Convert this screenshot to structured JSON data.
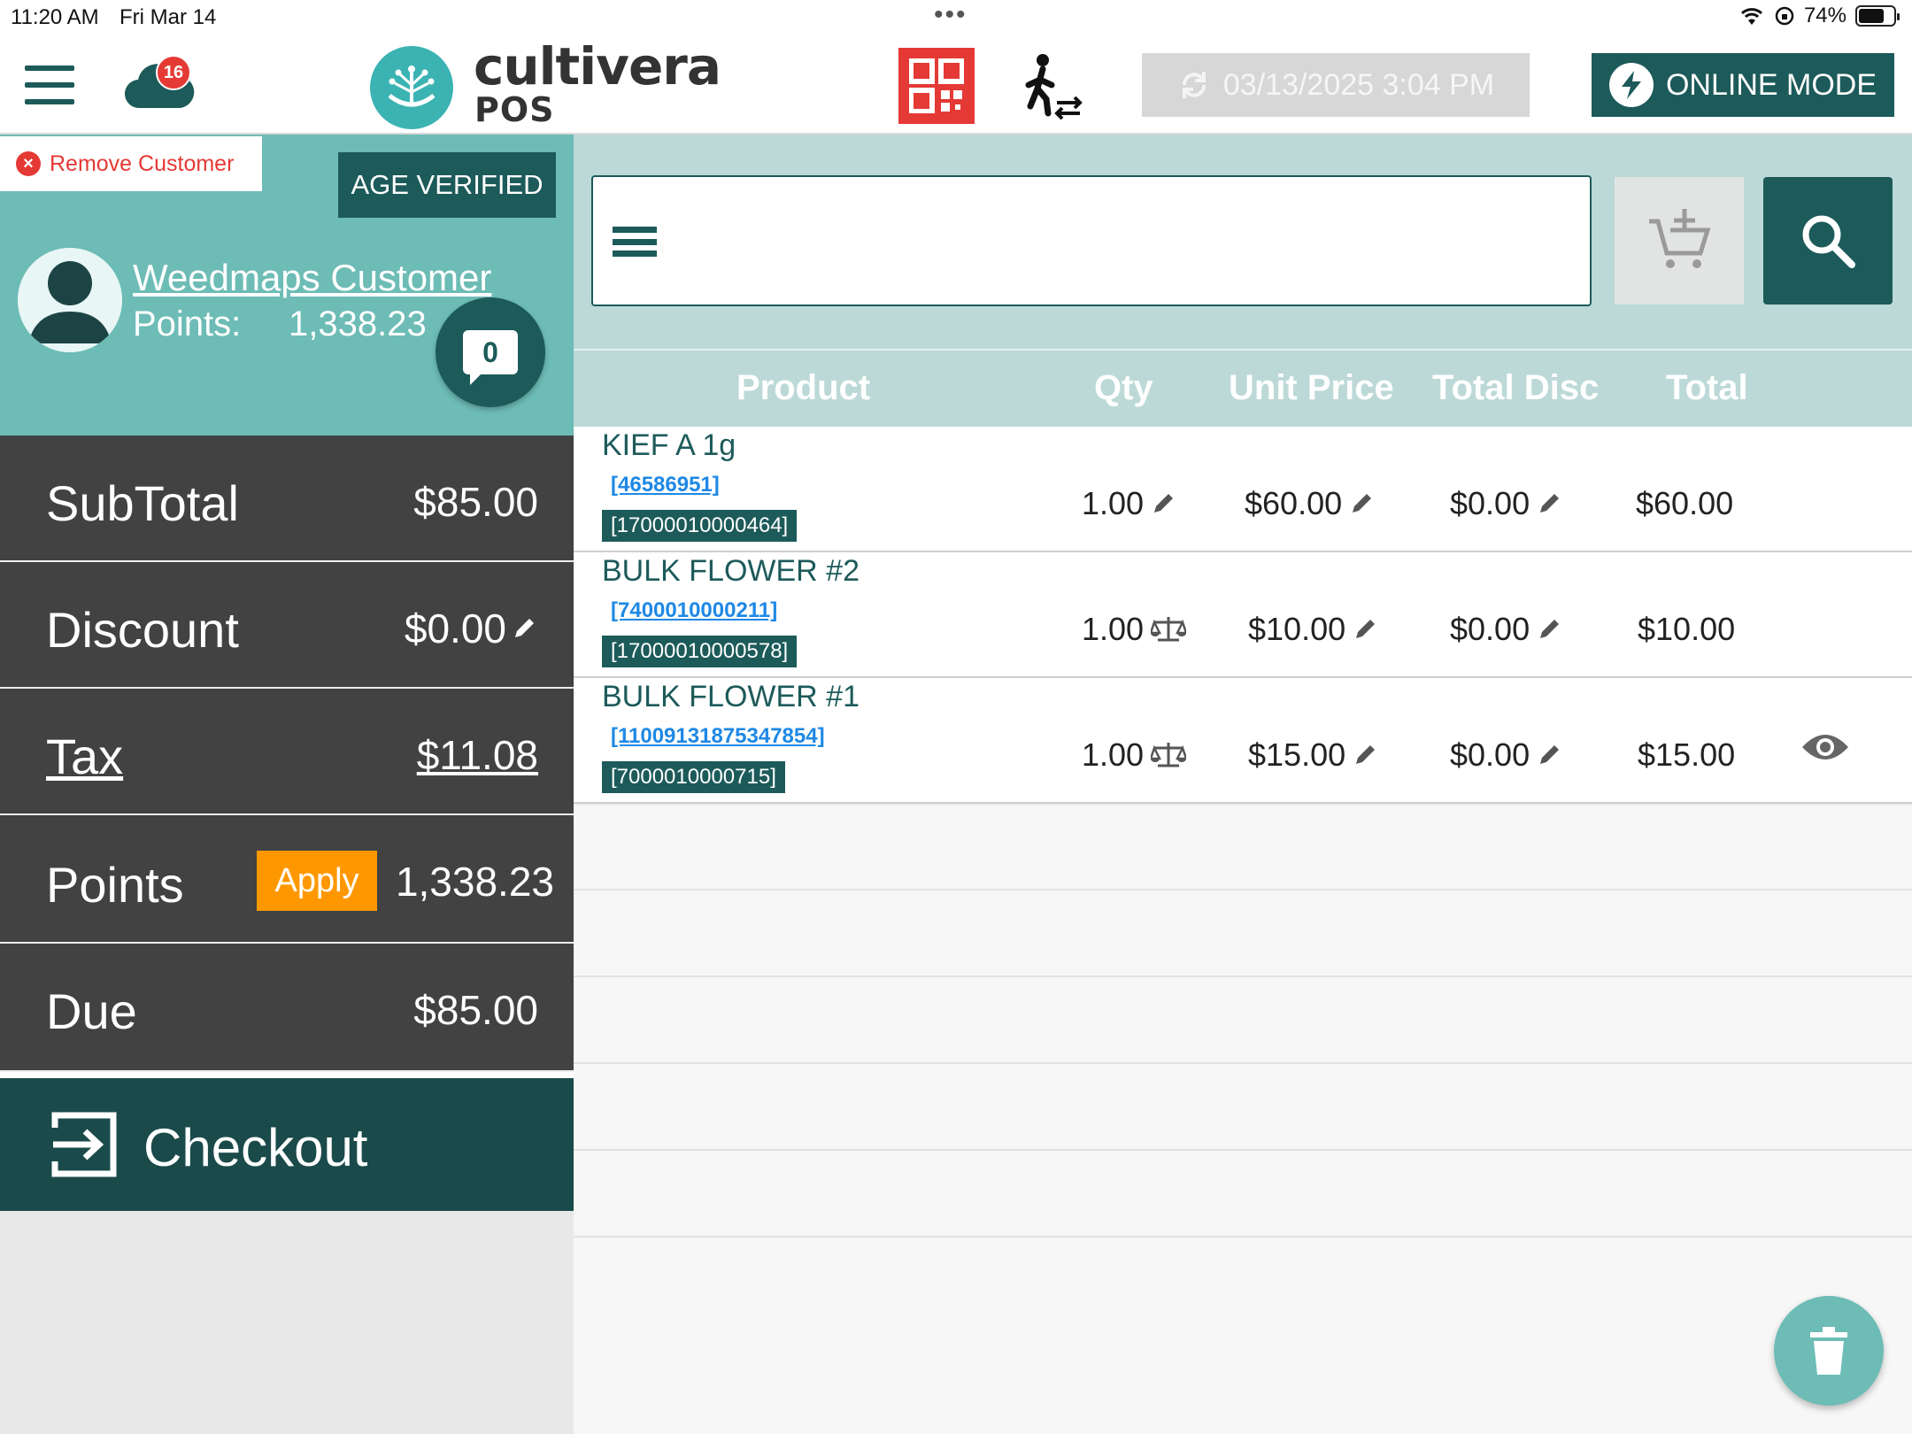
{
  "status_bar": {
    "time": "11:20 AM",
    "date": "Fri Mar 14",
    "battery": "74%",
    "battery_level": 0.74
  },
  "header": {
    "notification_count": "16",
    "brand_name": "cultivera",
    "brand_sub": "POS",
    "sync_time": "03/13/2025 3:04 PM",
    "online_mode_label": "ONLINE MODE",
    "icons": [
      "menu-icon",
      "cloud-icon",
      "qr-code-icon",
      "walk-in-icon",
      "sync-icon",
      "lightning-icon"
    ]
  },
  "customer": {
    "remove_label": "Remove Customer",
    "age_verified_label": "AGE VERIFIED",
    "name": "Weedmaps Customer",
    "points_label": "Points:",
    "points_value": "1,338.23",
    "message_count": "0"
  },
  "totals": {
    "subtotal_label": "SubTotal",
    "subtotal_value": "$85.00",
    "discount_label": "Discount",
    "discount_value": "$0.00",
    "tax_label": "Tax",
    "tax_value": "$11.08",
    "points_label": "Points",
    "apply_label": "Apply",
    "points_value": "1,338.23",
    "due_label": "Due",
    "due_value": "$85.00",
    "checkout_label": "Checkout"
  },
  "search": {
    "placeholder": ""
  },
  "table": {
    "headers": {
      "product": "Product",
      "qty": "Qty",
      "unit_price": "Unit Price",
      "total_disc": "Total Disc",
      "total": "Total"
    },
    "rows": [
      {
        "name": "KIEF A 1g",
        "link": "[46586951]",
        "barcode": "[17000010000464]",
        "qty": "1.00",
        "qty_icon": "pencil-icon",
        "unit_price": "$60.00",
        "total_disc": "$0.00",
        "total": "$60.00"
      },
      {
        "name": "BULK FLOWER #2",
        "link": "[7400010000211]",
        "barcode": "[17000010000578]",
        "qty": "1.00",
        "qty_icon": "scale-icon",
        "unit_price": "$10.00",
        "total_disc": "$0.00",
        "total": "$10.00"
      },
      {
        "name": "BULK FLOWER #1",
        "link": "[11009131875347854]",
        "barcode": "[7000010000715]",
        "qty": "1.00",
        "qty_icon": "scale-icon",
        "unit_price": "$15.00",
        "total_disc": "$0.00",
        "total": "$15.00"
      }
    ]
  },
  "colors": {
    "brand_dark": "#1d5a5a",
    "brand_teal": "#6dbcb6",
    "panel_dark": "#424242",
    "apply_orange": "#ff9800",
    "alert_red": "#e53935",
    "link_blue": "#1e88e5"
  }
}
